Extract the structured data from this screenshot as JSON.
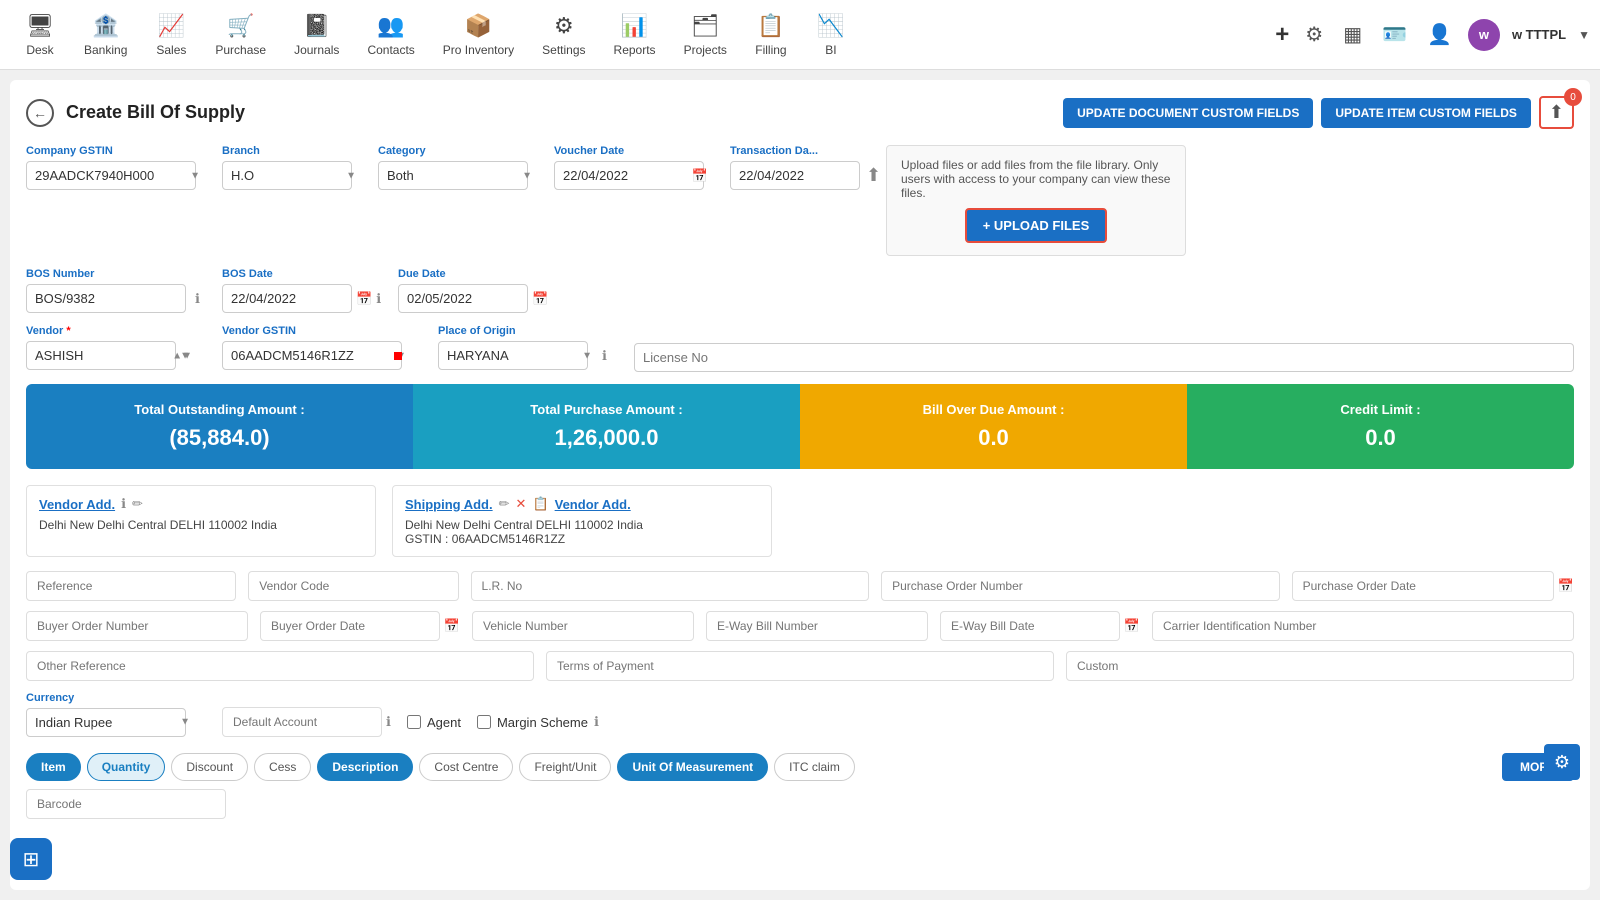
{
  "nav": {
    "items": [
      {
        "id": "desk",
        "icon": "🖥",
        "label": "Desk"
      },
      {
        "id": "banking",
        "icon": "🏦",
        "label": "Banking"
      },
      {
        "id": "sales",
        "icon": "📈",
        "label": "Sales"
      },
      {
        "id": "purchase",
        "icon": "🛒",
        "label": "Purchase"
      },
      {
        "id": "journals",
        "icon": "📓",
        "label": "Journals"
      },
      {
        "id": "contacts",
        "icon": "👥",
        "label": "Contacts"
      },
      {
        "id": "pro-inventory",
        "icon": "📦",
        "label": "Pro Inventory"
      },
      {
        "id": "settings",
        "icon": "⚙",
        "label": "Settings"
      },
      {
        "id": "reports",
        "icon": "📊",
        "label": "Reports"
      },
      {
        "id": "projects",
        "icon": "🗂",
        "label": "Projects"
      },
      {
        "id": "filling",
        "icon": "📋",
        "label": "Filling"
      },
      {
        "id": "bi",
        "icon": "📉",
        "label": "BI"
      }
    ],
    "company": "w TTTPL"
  },
  "page": {
    "title": "Create Bill Of Supply",
    "btn_update_doc": "UPDATE DOCUMENT CUSTOM FIELDS",
    "btn_update_item": "UPDATE ITEM CUSTOM FIELDS",
    "badge_count": "0"
  },
  "upload_panel": {
    "text": "Upload files or add files from the file library. Only users with access to your company can view these files.",
    "btn_label": "+ UPLOAD FILES"
  },
  "form": {
    "company_gstin_label": "Company GSTIN",
    "company_gstin_value": "29AADCK7940H000",
    "branch_label": "Branch",
    "branch_value": "H.O",
    "category_label": "Category",
    "category_value": "Both",
    "voucher_date_label": "Voucher Date",
    "voucher_date_value": "22/04/2022",
    "transaction_date_label": "Transaction Da...",
    "transaction_date_value": "22/04/2022",
    "bos_number_label": "BOS Number",
    "bos_number_value": "BOS/9382",
    "bos_date_label": "BOS Date",
    "bos_date_value": "22/04/2022",
    "due_date_label": "Due Date",
    "due_date_value": "02/05/2022",
    "vendor_label": "Vendor",
    "vendor_value": "ASHISH",
    "vendor_gstin_label": "Vendor GSTIN",
    "vendor_gstin_value": "06AADCM5146R1ZZ",
    "place_of_origin_label": "Place of Origin",
    "place_of_origin_value": "HARYANA",
    "license_no_placeholder": "License No"
  },
  "summary_cards": [
    {
      "id": "outstanding",
      "title": "Total Outstanding Amount :",
      "value": "(85,884.0)",
      "color": "card-blue"
    },
    {
      "id": "purchase",
      "title": "Total Purchase Amount :",
      "value": "1,26,000.0",
      "color": "card-cyan"
    },
    {
      "id": "overdue",
      "title": "Bill Over Due Amount :",
      "value": "0.0",
      "color": "card-yellow"
    },
    {
      "id": "credit",
      "title": "Credit Limit :",
      "value": "0.0",
      "color": "card-green"
    }
  ],
  "vendor_add": {
    "label": "Vendor Add.",
    "address": "Delhi New Delhi Central DELHI 110002 India"
  },
  "shipping_add": {
    "label": "Shipping Add.",
    "vendor_add_label": "Vendor Add.",
    "address": "Delhi New Delhi Central DELHI 110002 India",
    "gstin_label": "GSTIN :",
    "gstin_value": "06AADCM5146R1ZZ"
  },
  "fields_row1": {
    "reference_placeholder": "Reference",
    "vendor_code_placeholder": "Vendor Code",
    "lr_no_placeholder": "L.R. No",
    "purchase_order_number_placeholder": "Purchase Order Number",
    "purchase_order_date_placeholder": "Purchase Order Date"
  },
  "fields_row2": {
    "buyer_order_number_placeholder": "Buyer Order Number",
    "buyer_order_date_placeholder": "Buyer Order Date",
    "vehicle_number_placeholder": "Vehicle Number",
    "eway_bill_number_placeholder": "E-Way Bill Number",
    "eway_bill_date_placeholder": "E-Way Bill Date",
    "carrier_id_placeholder": "Carrier Identification Number"
  },
  "fields_row3": {
    "other_reference_placeholder": "Other Reference",
    "terms_of_payment_placeholder": "Terms of Payment",
    "custom_placeholder": "Custom"
  },
  "currency": {
    "label": "Currency",
    "value": "Indian Rupee",
    "default_account_placeholder": "Default Account",
    "agent_label": "Agent",
    "margin_scheme_label": "Margin Scheme"
  },
  "tabs": [
    {
      "id": "item",
      "label": "Item",
      "active": true
    },
    {
      "id": "quantity",
      "label": "Quantity",
      "active": true
    },
    {
      "id": "discount",
      "label": "Discount",
      "active": false
    },
    {
      "id": "cess",
      "label": "Cess",
      "active": false
    },
    {
      "id": "description",
      "label": "Description",
      "active": true
    },
    {
      "id": "cost-centre",
      "label": "Cost Centre",
      "active": false
    },
    {
      "id": "freight-unit",
      "label": "Freight/Unit",
      "active": false
    },
    {
      "id": "uom",
      "label": "Unit Of Measurement",
      "active": true
    },
    {
      "id": "itc-claim",
      "label": "ITC claim",
      "active": false
    }
  ],
  "more_btn": "MORE",
  "barcode_placeholder": "Barcode"
}
